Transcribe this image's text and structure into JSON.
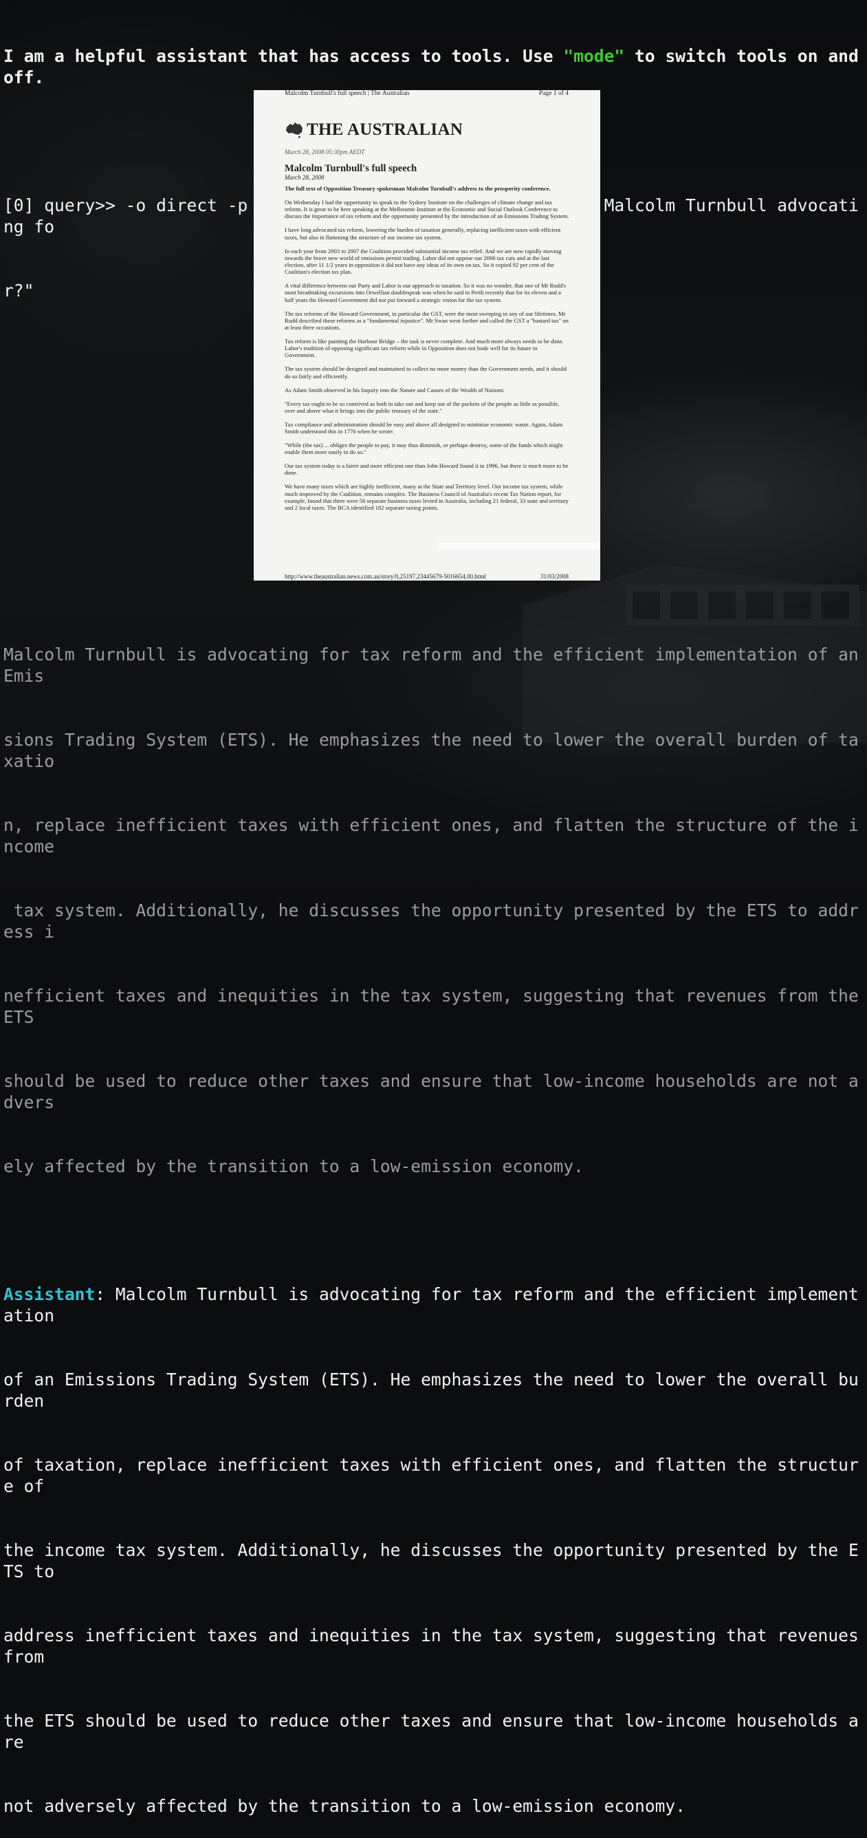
{
  "intro": {
    "before": "I am a helpful assistant that has access to tools. Use ",
    "keyword": "\"mode\"",
    "after": " to switch tools on and off."
  },
  "prompt": {
    "line1": "[0] query>> -o direct -p docs/turnbull-speech.pdf \"what is Malcolm Turnbull advocating fo",
    "line2": "r?\""
  },
  "pdf": {
    "header_left": "Malcolm Turnbull's full speech | The Australian",
    "header_right": "Page 1 of 4",
    "logo": "THE AUSTRALIAN",
    "dateline": "March 28, 2008 05:30pm AEDT",
    "title": "Malcolm Turnbull's full speech",
    "subdate": "March 28, 2008",
    "paragraphs": [
      "The full text of Opposition Treasury spokesman Malcolm Turnbull's address to the prosperity conference.",
      "On Wednesday I had the opportunity to speak to the Sydney Institute on the challenges of climate change and tax reform. It is great to be here speaking at the Melbourne Institute at the Economic and Social Outlook Conference to discuss the importance of tax reform and the opportunity presented by the introduction of an Emissions Trading System.",
      "I have long advocated tax reform, lowering the burden of taxation generally, replacing inefficient taxes with efficient taxes, but also in flattening the structure of our income tax system.",
      "In each year from 2003 to 2007 the Coalition provided substantial income tax relief. And we are now rapidly moving towards the brave new world of emissions permit trading. Labor did not oppose our 2006 tax cuts and at the last election, after 11 1/2 years in opposition it did not have any ideas of its own on tax. So it copied 92 per cent of the Coalition's election tax plan.",
      "A vital difference between our Party and Labor is our approach to taxation. So it was no wonder, that one of Mr Rudd's most breathtaking excursions into Orwellian doublespeak was when he said in Perth recently that for its eleven and a half years the Howard Government did not put forward a strategic vision for the tax system.",
      "The tax reforms of the Howard Government, in particular the GST, were the most sweeping in any of our lifetimes. Mr Rudd described these reforms as a \"fundamental injustice\". Mr Swan went further and called the GST a \"bastard tax\" on at least three occasions.",
      "Tax reform is like painting the Harbour Bridge – the task is never complete. And much more always needs to be done. Labor's tradition of opposing significant tax reform while in Opposition does not bode well for its future in Government.",
      "The tax system should be designed and maintained to collect no more money than the Government needs, and it should do so fairly and efficiently.",
      "As Adam Smith observed in his Inquiry into the Nature and Causes of the Wealth of Nations:",
      "\"Every tax ought to be so contrived as both to take out and keep out of the pockets of the people as little as possible, over and above what it brings into the public treasury of the state.\"",
      "Tax compliance and administration should be easy and above all designed to minimise economic waste. Again, Adam Smith understood this in 1776 when he wrote:",
      "\"While (the tax) ... obliges the people to pay, it may thus diminish, or perhaps destroy, some of the funds which might enable them more easily to do so.\"",
      "Our tax system today is a fairer and more efficient one than John Howard found it in 1996, but there is much more to be done.",
      "We have many taxes which are highly inefficient, many at the State and Territory level. Our income tax system, while much improved by the Coalition, remains complex. The Business Council of Australia's recent Tax Nation report, for example, found that there were 56 separate business taxes levied in Australia, including 21 federal, 33 state and territory and 2 local taxes. The BCA identified 182 separate taxing points."
    ],
    "footer_left": "http://www.theaustralian.news.com.au/story/0,25197,23445679-5016654,00.html",
    "footer_right": "31/03/2008"
  },
  "response": {
    "lines": [
      "Malcolm Turnbull is advocating for tax reform and the efficient implementation of an Emis",
      "sions Trading System (ETS). He emphasizes the need to lower the overall burden of taxatio",
      "n, replace inefficient taxes with efficient ones, and flatten the structure of the income",
      " tax system. Additionally, he discusses the opportunity presented by the ETS to address i",
      "nefficient taxes and inequities in the tax system, suggesting that revenues from the ETS ",
      "should be used to reduce other taxes and ensure that low-income households are not advers",
      "ely affected by the transition to a low-emission economy."
    ]
  },
  "assistant": {
    "label": "Assistant",
    "first_line": ": Malcolm Turnbull is advocating for tax reform and the efficient implementation",
    "lines": [
      "of an Emissions Trading System (ETS). He emphasizes the need to lower the overall burden",
      "of taxation, replace inefficient taxes with efficient ones, and flatten the structure of",
      "the income tax system. Additionally, he discusses the opportunity presented by the ETS to",
      "address inefficient taxes and inequities in the tax system, suggesting that revenues from",
      "the ETS should be used to reduce other taxes and ensure that low-income households are",
      "not adversely affected by the transition to a low-emission economy."
    ]
  },
  "colors": {
    "keyword": "#3ecb2e",
    "assistant_label": "#2cc3d4",
    "dim_text": "#9c9c9c"
  }
}
